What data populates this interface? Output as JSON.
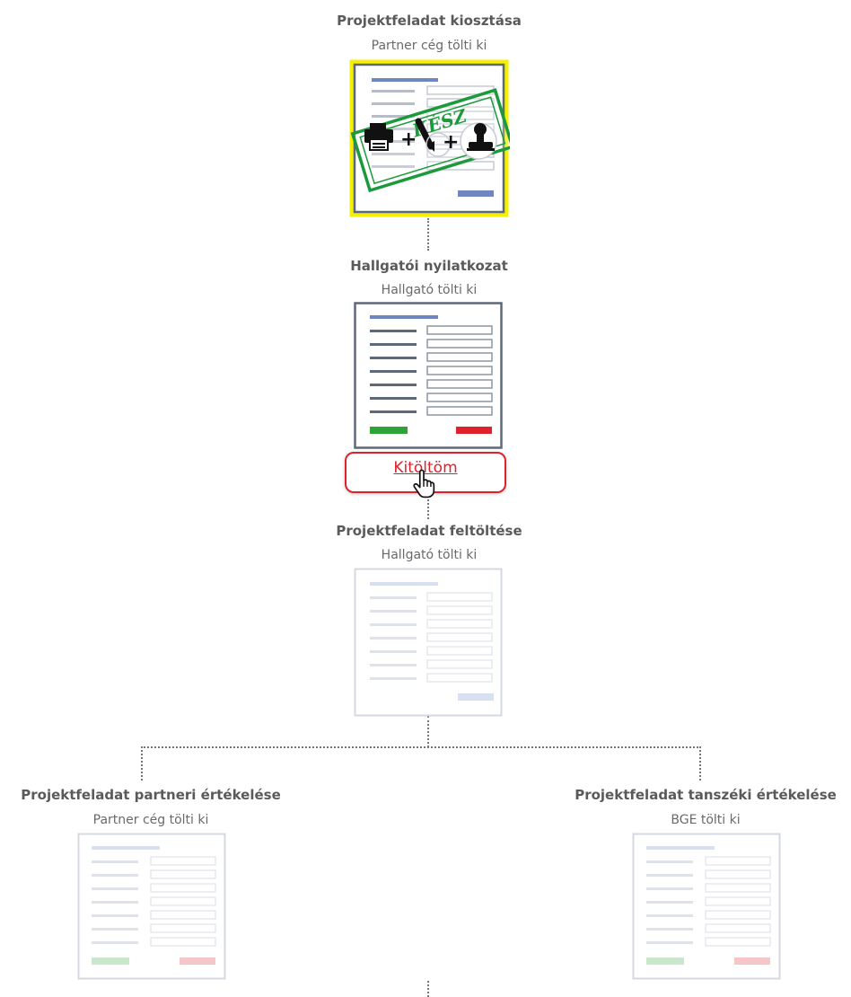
{
  "workflow": {
    "nodes": [
      {
        "title": "Projektfeladat kiosztása",
        "subtitle": "Partner cég tölti ki",
        "status": "done",
        "stamp_text": "KÉSZ"
      },
      {
        "title": "Hallgatói nyilatkozat",
        "subtitle": "Hallgató tölti ki",
        "status": "active",
        "action_label": "Kitöltöm"
      },
      {
        "title": "Projektfeladat feltöltése",
        "subtitle": "Hallgató tölti ki",
        "status": "pending"
      },
      {
        "title": "Projektfeladat partneri értékelése",
        "subtitle": "Partner cég tölti ki",
        "status": "pending"
      },
      {
        "title": "Projektfeladat tanszéki értékelése",
        "subtitle": "BGE tölti ki",
        "status": "pending"
      }
    ]
  },
  "colors": {
    "highlight": "#f5f000",
    "doc_border": "#5d6878",
    "doc_line": "#6f86c0",
    "accept": "#2fa336",
    "reject": "#e0202a",
    "action": "#e0202a",
    "stamp": "#1a9a3a"
  },
  "icons": [
    "printer-icon",
    "pen-icon",
    "stamp-icon",
    "hand-cursor-icon"
  ]
}
